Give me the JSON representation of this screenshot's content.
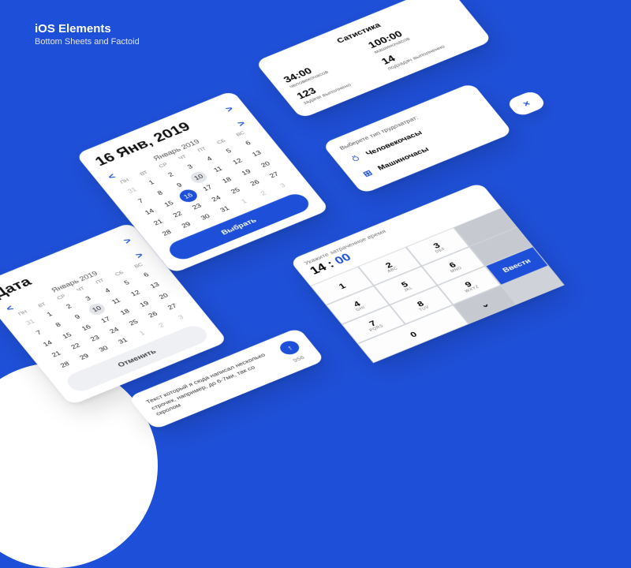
{
  "header": {
    "title": "iOS Elements",
    "subtitle": "Bottom Sheets and Factoid"
  },
  "colors": {
    "accent": "#1e4fd8"
  },
  "dow": [
    "ПН",
    "ВТ",
    "СР",
    "ЧТ",
    "ПТ",
    "СБ",
    "ВС"
  ],
  "calendar1": {
    "title": "Дата",
    "month_label": "Январь 2019",
    "leading_muted": [
      31
    ],
    "days": [
      1,
      2,
      3,
      4,
      5,
      6,
      7,
      8,
      9,
      10,
      11,
      12,
      13,
      14,
      15,
      16,
      17,
      18,
      19,
      20,
      21,
      22,
      23,
      24,
      25,
      26,
      27,
      28,
      29,
      30,
      31
    ],
    "trailing_muted": [
      1,
      2,
      3
    ],
    "highlight_light": 10,
    "cancel_label": "Отменить"
  },
  "calendar2": {
    "title": "16 Янв, 2019",
    "month_label": "Январь 2019",
    "leading_muted": [
      31
    ],
    "days": [
      1,
      2,
      3,
      4,
      5,
      6,
      7,
      8,
      9,
      10,
      11,
      12,
      13,
      14,
      15,
      16,
      17,
      18,
      19,
      20,
      21,
      22,
      23,
      24,
      25,
      26,
      27,
      28,
      29,
      30,
      31
    ],
    "trailing_muted": [
      1,
      2,
      3
    ],
    "highlight_light": 10,
    "highlight_fill": 16,
    "select_label": "Выбрать"
  },
  "stats": {
    "title": "Сатистика",
    "cells": [
      {
        "value": "34:00",
        "label": "человекочасов"
      },
      {
        "value": "100:00",
        "label": "машиночасов"
      },
      {
        "value": "123",
        "label": "задачи выполнено"
      },
      {
        "value": "14",
        "label": "подзадач выполненно"
      }
    ]
  },
  "effort": {
    "title": "Выберете тип трудозатрат:",
    "options": [
      {
        "icon": "person-icon",
        "label": "Человекочасы"
      },
      {
        "icon": "machine-icon",
        "label": "Машиночасы"
      }
    ]
  },
  "fab": {
    "label": "×"
  },
  "keypad": {
    "title": "Укажите затраченное время",
    "hh": "14",
    "sep": " : ",
    "mm": "00",
    "side_label": "",
    "enter_label": "Ввести",
    "keys": [
      {
        "n": "1",
        "s": ""
      },
      {
        "n": "2",
        "s": "ABC"
      },
      {
        "n": "3",
        "s": "DEF"
      },
      {
        "n": "4",
        "s": "GHI"
      },
      {
        "n": "5",
        "s": "JKL"
      },
      {
        "n": "6",
        "s": "MNO"
      },
      {
        "n": "7",
        "s": "PQRS"
      },
      {
        "n": "8",
        "s": "TUV"
      },
      {
        "n": "9",
        "s": "WXYZ"
      },
      {
        "n": "0",
        "s": ""
      }
    ]
  },
  "message": {
    "text": "Текст который я сюда написал несколько строчек, например, до 6-7ми, так со скролом",
    "counter": "956"
  }
}
